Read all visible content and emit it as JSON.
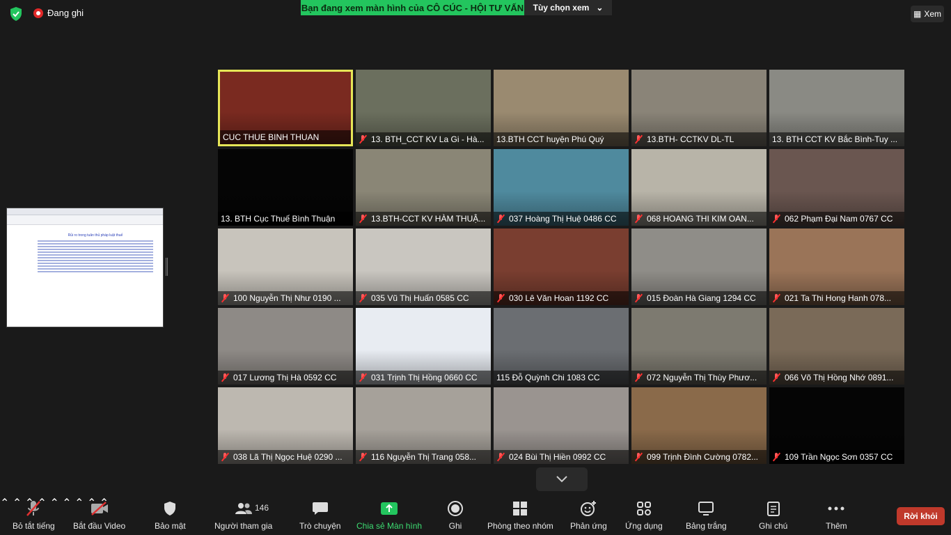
{
  "top": {
    "recording_label": "Đang ghi",
    "share_banner": "Bạn đang xem màn hình của CÔ CÚC - HỘI TƯ VẤN",
    "view_options": "Tùy chọn xem",
    "view_button": "Xem"
  },
  "shared_doc": {
    "title": "Rủi ro trong tuân thủ pháp luật thuế"
  },
  "participants": [
    {
      "name": "CUC THUE BINH THUAN",
      "muted": false,
      "active": true
    },
    {
      "name": "13. BTH_CCT KV La Gi - Hà...",
      "muted": true
    },
    {
      "name": "13.BTH CCT huyện Phú Quý",
      "muted": false
    },
    {
      "name": "13.BTH- CCTKV DL-TL",
      "muted": true
    },
    {
      "name": "13. BTH CCT KV Bắc Bình-Tuy ...",
      "muted": false
    },
    {
      "name": "13. BTH Cục Thuế Bình Thuận",
      "muted": false
    },
    {
      "name": "13.BTH-CCT KV HÀM THUẬ...",
      "muted": true
    },
    {
      "name": "037 Hoàng Thị Huệ 0486 CC",
      "muted": true
    },
    {
      "name": "068 HOANG THI KIM OAN...",
      "muted": true
    },
    {
      "name": "062 Phạm Đại Nam 0767 CC",
      "muted": true
    },
    {
      "name": "100 Nguyễn Thị Như 0190 ...",
      "muted": true
    },
    {
      "name": "035 Vũ Thị Huấn 0585 CC",
      "muted": true
    },
    {
      "name": "030 Lê Văn Hoan 1192 CC",
      "muted": true
    },
    {
      "name": "015 Đoàn Hà Giang 1294 CC",
      "muted": true
    },
    {
      "name": "021 Ta Thi Hong Hanh 078...",
      "muted": true
    },
    {
      "name": "017 Lương Thị Hà 0592 CC",
      "muted": true
    },
    {
      "name": "031 Trịnh Thị Hồng 0660 CC",
      "muted": true
    },
    {
      "name": "115 Đỗ Quỳnh Chi 1083 CC",
      "muted": false
    },
    {
      "name": "072 Nguyễn Thị Thùy Phươ...",
      "muted": true
    },
    {
      "name": "066 Võ Thị Hồng Nhớ 0891...",
      "muted": true
    },
    {
      "name": "038 Lã Thị Ngọc Huệ 0290 ...",
      "muted": true
    },
    {
      "name": "116 Nguyễn Thị Trang 058...",
      "muted": true
    },
    {
      "name": "024 Bùi Thị Hiền 0992 CC",
      "muted": true
    },
    {
      "name": "099 Trịnh Đình Cường 0782...",
      "muted": true
    },
    {
      "name": "109 Trần Ngọc Sơn 0357 CC",
      "muted": true
    }
  ],
  "tile_scenes": [
    "#7a2a20",
    "#6b6f5e",
    "#9a8a70",
    "#8a8478",
    "#8a8a84",
    "#050505",
    "#8a8676",
    "#4f8a9e",
    "#b8b4a8",
    "#6a5650",
    "#c8c4bc",
    "#c9c6c0",
    "#7a3e30",
    "#8f8d88",
    "#9a7458",
    "#8e8a86",
    "#e8ecf2",
    "#6b6e72",
    "#7d7a70",
    "#7a6a58",
    "#bdb8b0",
    "#a6a19a",
    "#9a9490",
    "#8a6a4a",
    "#050505"
  ],
  "toolbar": {
    "mute": "Bỏ tắt tiếng",
    "video": "Bắt đầu Video",
    "security": "Bảo mật",
    "participants": "Người tham gia",
    "participant_count": "146",
    "chat": "Trò chuyện",
    "share": "Chia sẻ Màn hình",
    "record": "Ghi",
    "breakout": "Phòng theo nhóm",
    "reactions": "Phản ứng",
    "apps": "Ứng dụng",
    "whiteboard": "Bảng trắng",
    "notes": "Ghi chú",
    "more": "Thêm",
    "leave": "Rời khỏi"
  }
}
